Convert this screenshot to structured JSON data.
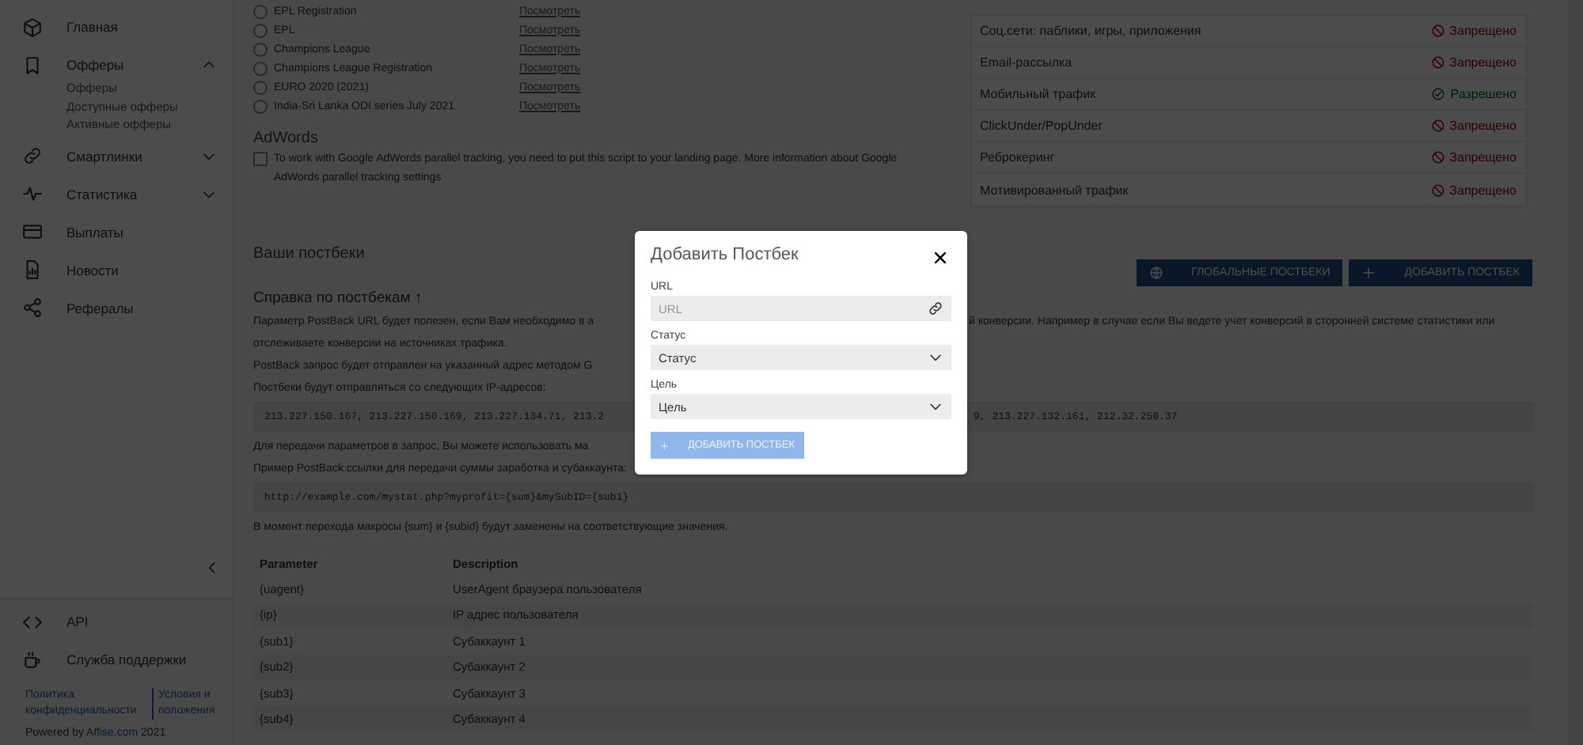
{
  "sidebar": {
    "nav": [
      {
        "label": "Главная",
        "kind": "link"
      },
      {
        "label": "Офферы",
        "kind": "group",
        "expanded": true,
        "children": [
          {
            "label": "Офферы"
          },
          {
            "label": "Доступные офферы"
          },
          {
            "label": "Активные офферы"
          }
        ]
      },
      {
        "label": "Смартлинки",
        "kind": "group",
        "expanded": false
      },
      {
        "label": "Статистика",
        "kind": "group",
        "expanded": false
      },
      {
        "label": "Выплаты",
        "kind": "link"
      },
      {
        "label": "Новости",
        "kind": "link"
      },
      {
        "label": "Рефералы",
        "kind": "link"
      }
    ],
    "footer_items": [
      {
        "label": "API"
      },
      {
        "label": "Служба поддержки"
      }
    ],
    "legal_links": [
      "Политика конфиденциальности",
      "Условия и положения"
    ],
    "powered": {
      "prefix": "Powered by",
      "link": "Affise.com",
      "suffix": "2021"
    }
  },
  "landings": [
    {
      "name": "EPL Registration",
      "link": "Посмотреть",
      "selected": false
    },
    {
      "name": "EPL",
      "link": "Посмотреть",
      "selected": false
    },
    {
      "name": "Champions League",
      "link": "Посмотреть",
      "selected": false
    },
    {
      "name": "Champions League Registration",
      "link": "Посмотреть",
      "selected": false
    },
    {
      "name": "EURO 2020 (2021)",
      "link": "Посмотреть",
      "selected": false
    },
    {
      "name": "India-Sri Lanka ODI series July 2021",
      "link": "Посмотреть",
      "selected": false
    }
  ],
  "adwords": {
    "title": "AdWords",
    "checked": false,
    "text": "To work with Google AdWords parallel tracking, you need to put this script to your landing page. More information about Google AdWords parallel tracking settings"
  },
  "traffic_rules": [
    {
      "label": "Соц.сети: паблики, игры, приложения",
      "status": "Запрещено",
      "kind": "forbidden"
    },
    {
      "label": "Email-рассылка",
      "status": "Запрещено",
      "kind": "forbidden"
    },
    {
      "label": "Мобильный трафик",
      "status": "Разрешено",
      "kind": "allowed"
    },
    {
      "label": "ClickUnder/PopUnder",
      "status": "Запрещено",
      "kind": "forbidden"
    },
    {
      "label": "Реброкеринг",
      "status": "Запрещено",
      "kind": "forbidden"
    },
    {
      "label": "Мотивированный трафик",
      "status": "Запрещено",
      "kind": "forbidden"
    }
  ],
  "postbacks": {
    "title": "Ваши постбеки",
    "buttons": [
      {
        "label": "ГЛОБАЛЬНЫЕ ПОСТБЕКИ",
        "kind": "global"
      },
      {
        "label": "ДОБАВИТЬ ПОСТБЕК",
        "kind": "add"
      }
    ],
    "help_title": "Справка по постбекам ↑",
    "lines": [
      {
        "kind": "text",
        "left": "Параметр PostBack URL будет полезен, если Вам необходимо в а",
        "right": "й конверсии. Например в случае если Вы ведете учет конверсий в сторонней системе статистики или"
      },
      {
        "kind": "text",
        "left": "отслеживаете конверсии на источниках трафика."
      },
      {
        "kind": "text",
        "left": "PostBack запрос будет отправлен на указанный адрес методом G"
      },
      {
        "kind": "text",
        "left": "Постбеки будут отправляться со следующих IP-адресов:"
      },
      {
        "kind": "code",
        "left": "213.227.150.167, 213.227.150.169, 213.227.134.71, 213.2",
        "right": "9, 213.227.132.161, 212.32.250.37"
      },
      {
        "kind": "text",
        "left": "Для передачи параметров в запрос, Вы можете использовать ма"
      },
      {
        "kind": "text",
        "left": "Пример PostBack ссылки для передачи суммы заработка и субаккаунта:"
      },
      {
        "kind": "code",
        "left": "http://example.com/mystat.php?myprofit={sum}&mySubID={sub1}"
      },
      {
        "kind": "text",
        "left": "В момент перехода макросы {sum} и {subid} будут заменены на соответствующие значения."
      }
    ],
    "params": {
      "columns": [
        "Parameter",
        "Description"
      ],
      "rows": [
        [
          "{uagent}",
          "UserAgent браузера пользователя"
        ],
        [
          "{ip}",
          "IP адрес пользователя"
        ],
        [
          "{sub1}",
          "Субаккаунт 1"
        ],
        [
          "{sub2}",
          "Субаккаунт 2"
        ],
        [
          "{sub3}",
          "Субаккаунт 3"
        ],
        [
          "{sub4}",
          "Субаккаунт 4"
        ]
      ]
    }
  },
  "modal": {
    "title": "Добавить Постбек",
    "fields": [
      {
        "label": "URL",
        "kind": "input",
        "placeholder": "URL"
      },
      {
        "label": "Статус",
        "kind": "select",
        "value": "Статус"
      },
      {
        "label": "Цель",
        "kind": "select",
        "value": "Цель"
      }
    ],
    "button": {
      "label": "ДОБАВИТЬ ПОСТБЕК",
      "disabled": true
    }
  }
}
